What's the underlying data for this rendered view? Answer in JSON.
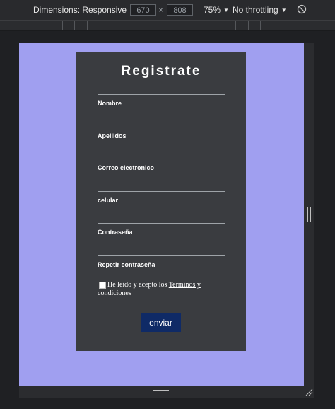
{
  "toolbar": {
    "dimensions_label": "Dimensions: Responsive",
    "width_value": "670",
    "times": "×",
    "height_value": "808",
    "zoom_label": "75%",
    "throttling_label": "No throttling",
    "caret": "▼"
  },
  "form": {
    "title": "Registrate",
    "fields": [
      {
        "label": "Nombre"
      },
      {
        "label": "Apellidos"
      },
      {
        "label": "Correo electronico"
      },
      {
        "label": "celular"
      },
      {
        "label": "Contraseña"
      },
      {
        "label": "Repetir contraseña"
      }
    ],
    "terms_text": "He leido y acepto los",
    "terms_link_line1": "Terminos y",
    "terms_link_line2": "condiciones",
    "submit_label": "enviar"
  },
  "colors": {
    "device_bg": "#a09ff0",
    "card_bg": "#3a3c40",
    "button_bg": "#0f2a66"
  }
}
